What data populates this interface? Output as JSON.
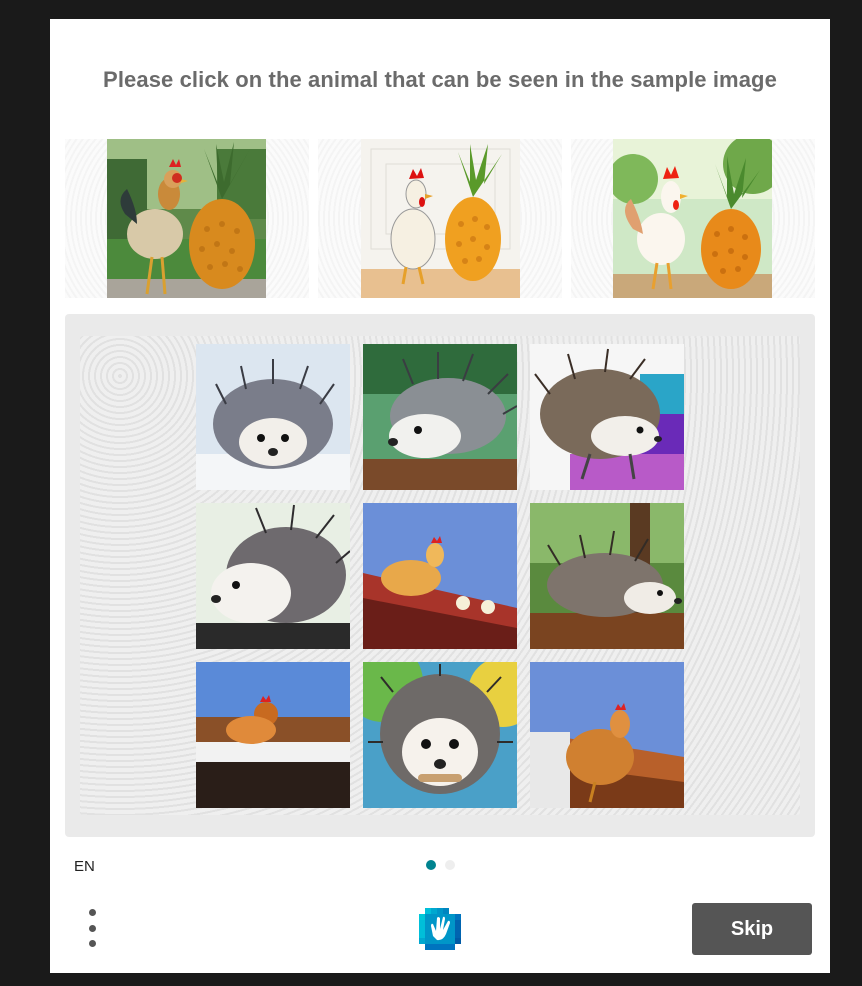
{
  "challenge": {
    "prompt": "Please click on the animal that can be seen in the sample image",
    "samples": [
      {
        "name": "rooster-pineapple-park"
      },
      {
        "name": "chicken-pineapple-cartoon"
      },
      {
        "name": "rooster-pineapple-garden"
      }
    ],
    "tiles": [
      {
        "subject": "hedgehog"
      },
      {
        "subject": "hedgehog"
      },
      {
        "subject": "hedgehog"
      },
      {
        "subject": "hedgehog"
      },
      {
        "subject": "chicken"
      },
      {
        "subject": "hedgehog"
      },
      {
        "subject": "chicken"
      },
      {
        "subject": "hedgehog"
      },
      {
        "subject": "chicken"
      }
    ]
  },
  "footer": {
    "language": "EN",
    "skip_label": "Skip",
    "logo_icon": "hcaptcha-hand-icon",
    "menu_icon": "more-vertical-icon"
  },
  "colors": {
    "skip_button": "#555555",
    "active_dot": "#00838f",
    "inactive_dot": "#eeeeee",
    "logo": "#0074bf",
    "logo_light": "#00bfd9"
  },
  "pagination": {
    "current": 1,
    "total": 2
  }
}
